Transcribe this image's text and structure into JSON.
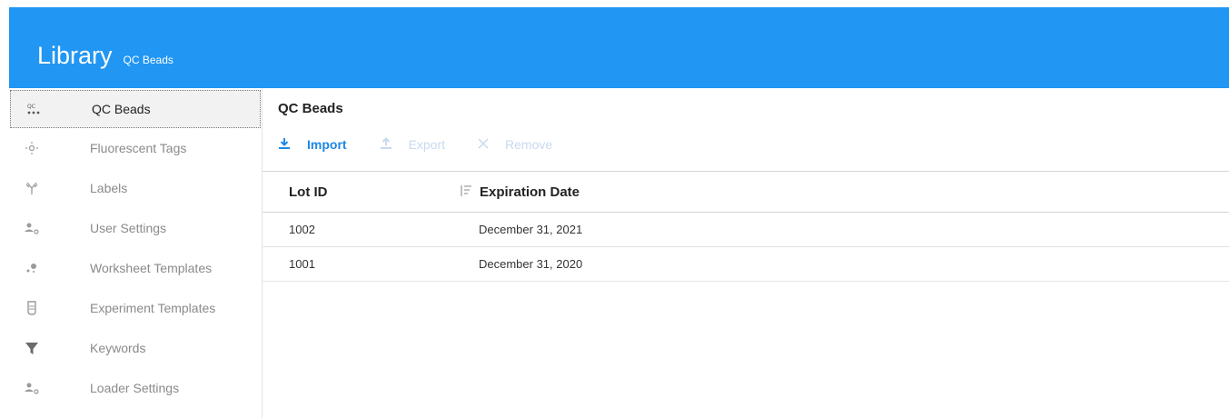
{
  "header": {
    "title": "Library",
    "subtitle": "QC Beads",
    "bg_color": "#2196f3"
  },
  "sidebar": {
    "items": [
      {
        "label": "QC Beads",
        "icon": "qc-beads-icon",
        "active": true
      },
      {
        "label": "Fluorescent Tags",
        "icon": "fluorescent-icon"
      },
      {
        "label": "Labels",
        "icon": "antibody-icon"
      },
      {
        "label": "User Settings",
        "icon": "user-settings-icon"
      },
      {
        "label": "Worksheet Templates",
        "icon": "worksheet-icon"
      },
      {
        "label": "Experiment Templates",
        "icon": "test-tube-icon"
      },
      {
        "label": "Keywords",
        "icon": "filter-icon"
      },
      {
        "label": "Loader Settings",
        "icon": "loader-settings-icon"
      }
    ]
  },
  "main": {
    "title": "QC Beads",
    "toolbar": {
      "import_label": "Import",
      "export_label": "Export",
      "remove_label": "Remove"
    },
    "table": {
      "columns": [
        "Lot ID",
        "Expiration Date"
      ],
      "rows": [
        {
          "lot_id": "1002",
          "expiration": "December 31, 2021"
        },
        {
          "lot_id": "1001",
          "expiration": "December 31, 2020"
        }
      ]
    }
  }
}
